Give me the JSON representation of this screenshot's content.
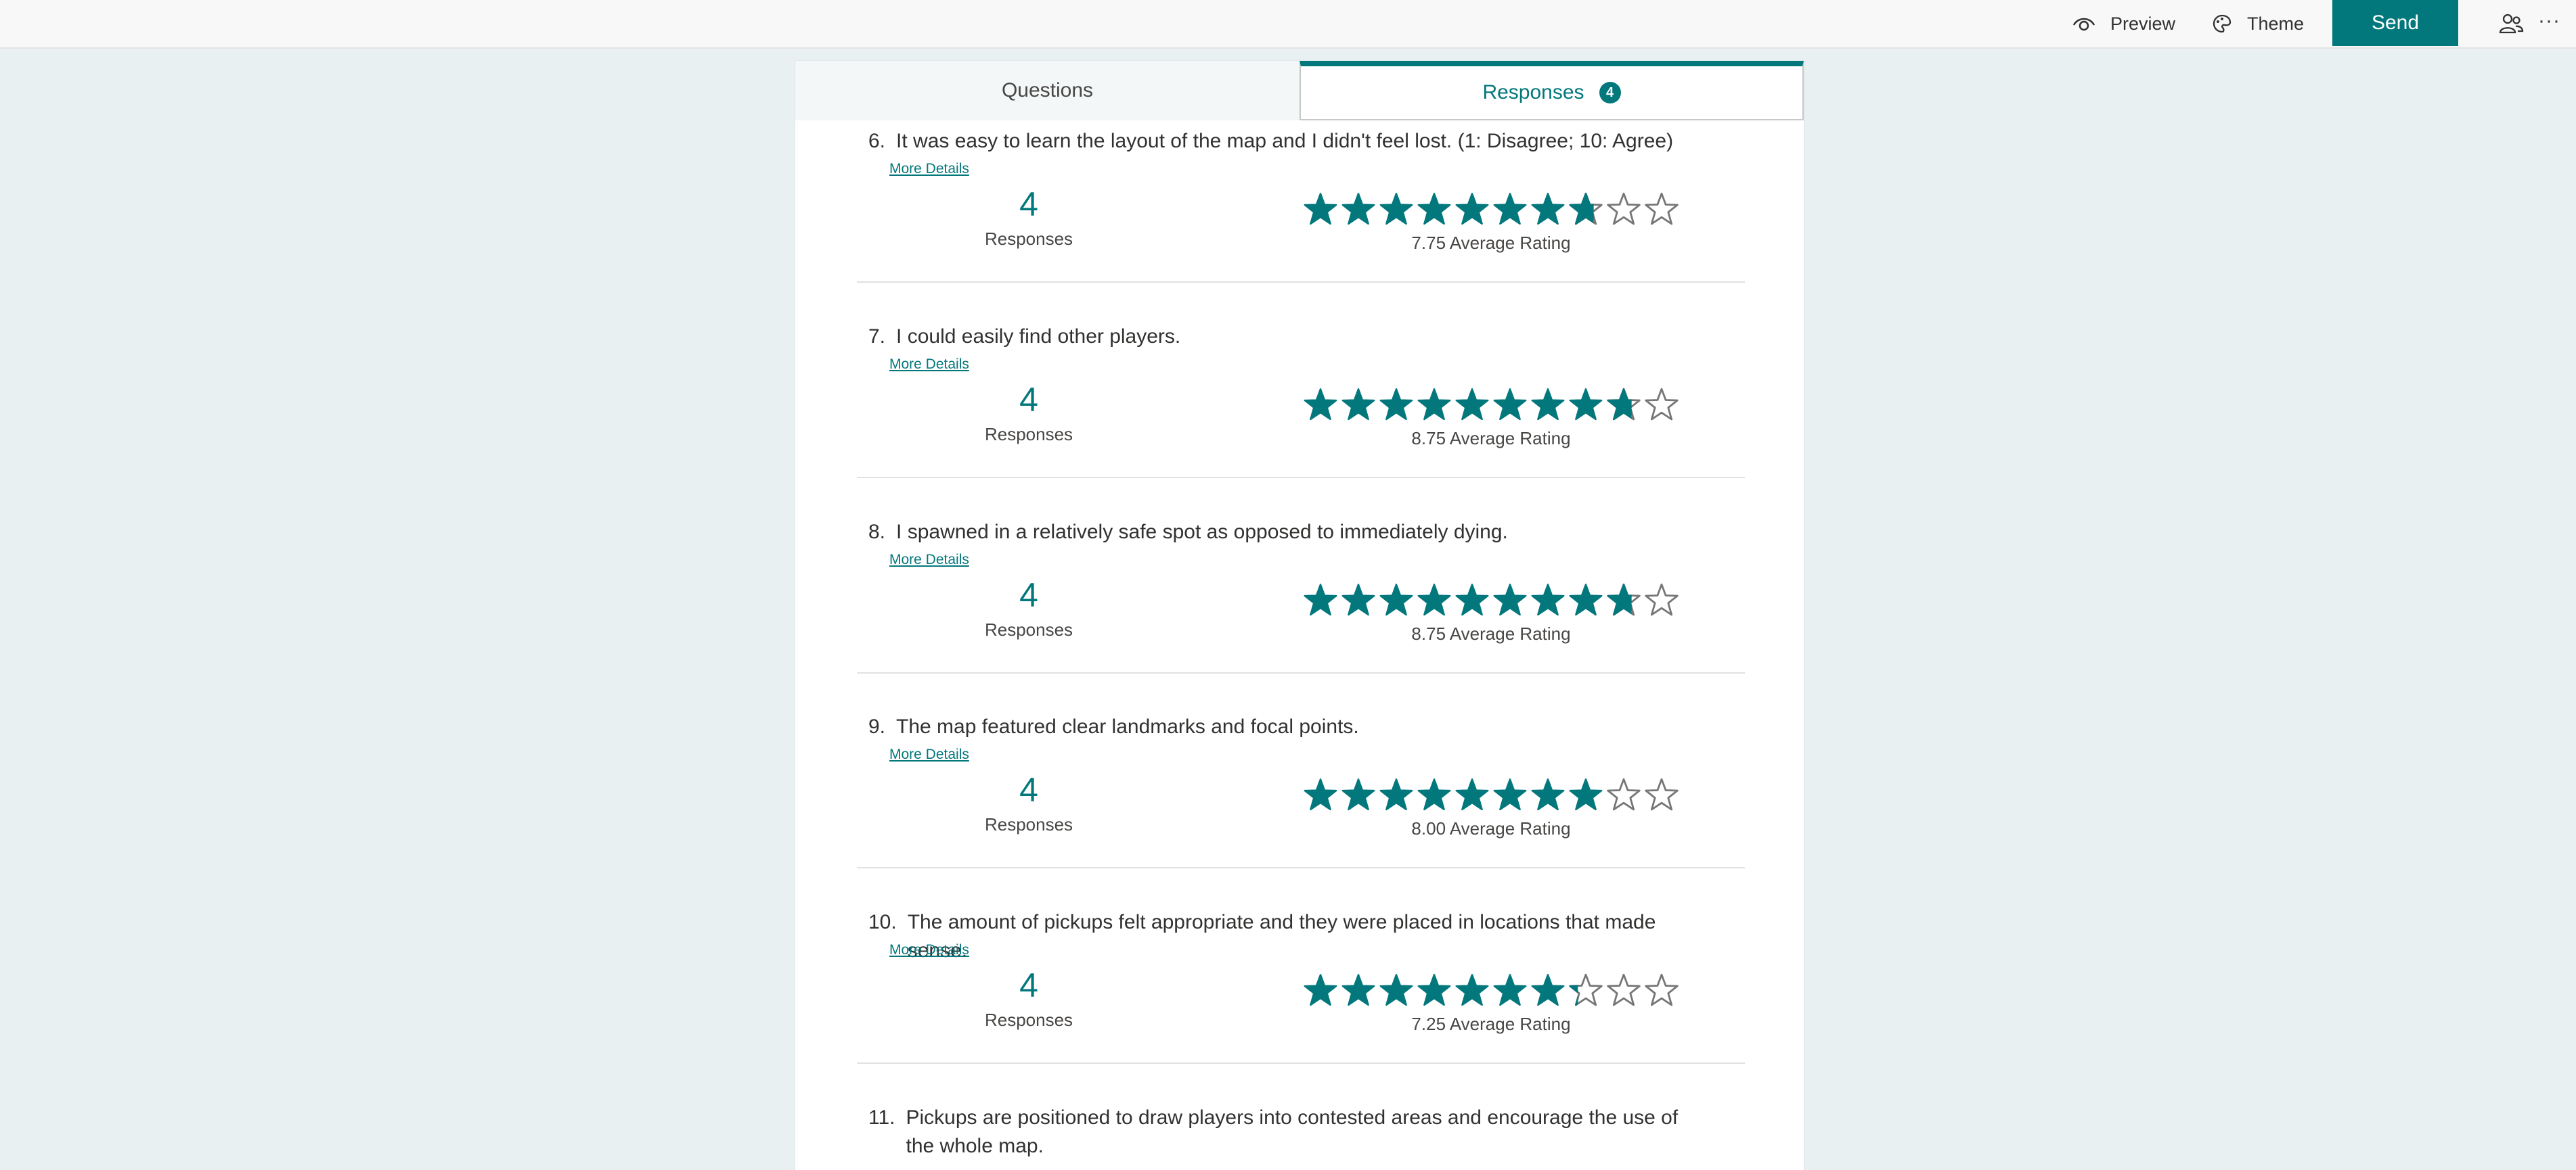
{
  "colors": {
    "accent": "#03787c",
    "send_bg": "#03787c",
    "star_filled": "#03787c",
    "star_empty": "#767676"
  },
  "toolbar": {
    "preview_label": "Preview",
    "preview_icon": "eye-icon",
    "theme_label": "Theme",
    "theme_icon": "palette-icon",
    "send_label": "Send",
    "share_icon": "people-icon",
    "more_label": "···"
  },
  "tabs": {
    "questions_label": "Questions",
    "responses_label": "Responses",
    "responses_count": "4"
  },
  "questions": [
    {
      "number": "6.",
      "text": "It was easy to learn the layout of the map and I didn't feel lost. (1: Disagree; 10: Agree)",
      "more_details": "More Details",
      "responses": "4",
      "responses_label": "Responses",
      "rating_text": "7.75 Average Rating",
      "rating": 7.75,
      "max_rating": 10
    },
    {
      "number": "7.",
      "text": "I could easily find other players.",
      "more_details": "More Details",
      "responses": "4",
      "responses_label": "Responses",
      "rating_text": "8.75 Average Rating",
      "rating": 8.75,
      "max_rating": 10
    },
    {
      "number": "8.",
      "text": "I spawned in a relatively safe spot as opposed to immediately dying.",
      "more_details": "More Details",
      "responses": "4",
      "responses_label": "Responses",
      "rating_text": "8.75 Average Rating",
      "rating": 8.75,
      "max_rating": 10
    },
    {
      "number": "9.",
      "text": "The map featured clear landmarks and focal points.",
      "more_details": "More Details",
      "responses": "4",
      "responses_label": "Responses",
      "rating_text": "8.00 Average Rating",
      "rating": 8.0,
      "max_rating": 10
    },
    {
      "number": "10.",
      "text": "The amount of pickups felt appropriate and they were placed in locations that made sense.",
      "more_details": "More Details",
      "responses": "4",
      "responses_label": "Responses",
      "rating_text": "7.25 Average Rating",
      "rating": 7.25,
      "max_rating": 10
    },
    {
      "number": "11.",
      "text": "Pickups are positioned to draw players into contested areas and encourage the use of the whole map."
    }
  ]
}
